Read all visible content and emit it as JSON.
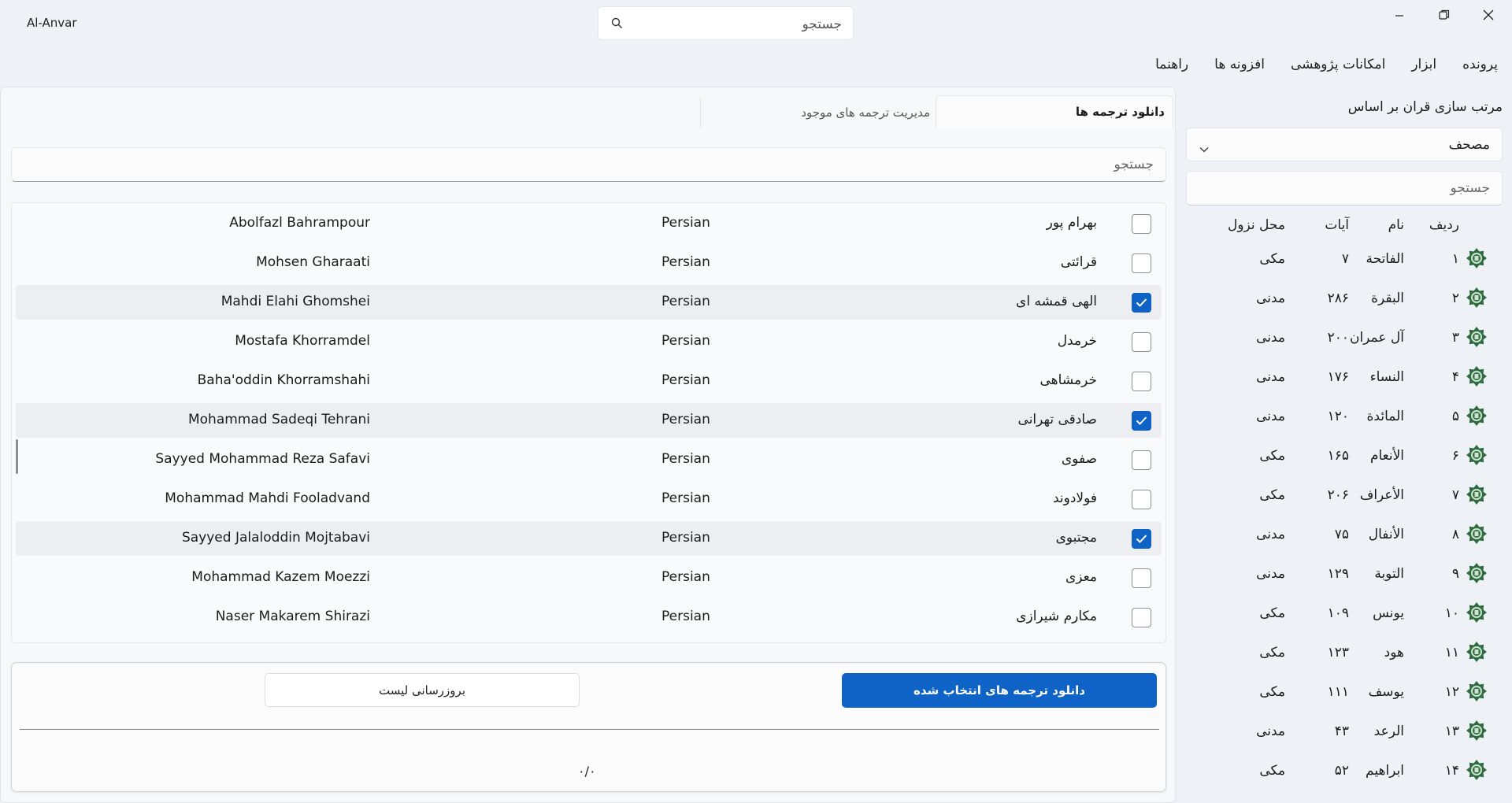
{
  "app": {
    "title": "Al-Anvar"
  },
  "top_search": {
    "placeholder": "جستجو"
  },
  "window_controls": [
    "minimize-icon",
    "restore-icon",
    "close-icon"
  ],
  "menu": [
    "پرونده",
    "ابزار",
    "امکانات پژوهشی",
    "افزونه ها",
    "راهنما"
  ],
  "sidebar": {
    "sort_label": "مرتب سازی قران بر اساس",
    "sort_value": "مصحف",
    "search_placeholder": "جستجو",
    "headers": {
      "index": "ردیف",
      "name": "نام",
      "ayat": "آیات",
      "place": "محل نزول"
    },
    "suras": [
      {
        "index": "۱",
        "name": "الفاتحة",
        "ayat": "۷",
        "place": "مکی"
      },
      {
        "index": "۲",
        "name": "البقرة",
        "ayat": "۲۸۶",
        "place": "مدنی"
      },
      {
        "index": "۳",
        "name": "آل عمران",
        "ayat": "۲۰۰",
        "place": "مدنی"
      },
      {
        "index": "۴",
        "name": "النساء",
        "ayat": "۱۷۶",
        "place": "مدنی"
      },
      {
        "index": "۵",
        "name": "المائدة",
        "ayat": "۱۲۰",
        "place": "مدنی"
      },
      {
        "index": "۶",
        "name": "الأنعام",
        "ayat": "۱۶۵",
        "place": "مکی"
      },
      {
        "index": "۷",
        "name": "الأعراف",
        "ayat": "۲۰۶",
        "place": "مکی"
      },
      {
        "index": "۸",
        "name": "الأنفال",
        "ayat": "۷۵",
        "place": "مدنی"
      },
      {
        "index": "۹",
        "name": "التوبة",
        "ayat": "۱۲۹",
        "place": "مدنی"
      },
      {
        "index": "۱۰",
        "name": "یونس",
        "ayat": "۱۰۹",
        "place": "مکی"
      },
      {
        "index": "۱۱",
        "name": "هود",
        "ayat": "۱۲۳",
        "place": "مکی"
      },
      {
        "index": "۱۲",
        "name": "یوسف",
        "ayat": "۱۱۱",
        "place": "مکی"
      },
      {
        "index": "۱۳",
        "name": "الرعد",
        "ayat": "۴۳",
        "place": "مدنی"
      },
      {
        "index": "۱۴",
        "name": "ابراهیم",
        "ayat": "۵۲",
        "place": "مکی"
      }
    ]
  },
  "tabs": {
    "active": "دانلود ترجمه ها",
    "other": "مدیریت ترجمه های موجود"
  },
  "main_search": {
    "placeholder": "جستجو"
  },
  "translations": [
    {
      "native": "بهرام پور",
      "lang": "Persian",
      "english": "Abolfazl Bahrampour",
      "checked": false
    },
    {
      "native": "قرائتی",
      "lang": "Persian",
      "english": "Mohsen Gharaati",
      "checked": false
    },
    {
      "native": "الهی قمشه ای",
      "lang": "Persian",
      "english": "Mahdi Elahi Ghomshei",
      "checked": true
    },
    {
      "native": "خرمدل",
      "lang": "Persian",
      "english": "Mostafa Khorramdel",
      "checked": false
    },
    {
      "native": "خرمشاهی",
      "lang": "Persian",
      "english": "Baha'oddin Khorramshahi",
      "checked": false
    },
    {
      "native": "صادقی تهرانی",
      "lang": "Persian",
      "english": "Mohammad Sadeqi Tehrani",
      "checked": true
    },
    {
      "native": "صفوی",
      "lang": "Persian",
      "english": "Sayyed Mohammad Reza Safavi",
      "checked": false
    },
    {
      "native": "فولادوند",
      "lang": "Persian",
      "english": "Mohammad Mahdi Fooladvand",
      "checked": false
    },
    {
      "native": "مجتبوی",
      "lang": "Persian",
      "english": "Sayyed Jalaloddin Mojtabavi",
      "checked": true
    },
    {
      "native": "معزی",
      "lang": "Persian",
      "english": "Mohammad Kazem Moezzi",
      "checked": false
    },
    {
      "native": "مکارم شیرازی",
      "lang": "Persian",
      "english": "Naser Makarem Shirazi",
      "checked": false
    }
  ],
  "actions": {
    "download_label": "دانلود ترجمه های انتخاب شده",
    "refresh_label": "بروزرسانی لیست",
    "progress_text": "۰/۰",
    "progress_value": 0
  },
  "colors": {
    "accent": "#0f63c6",
    "emblem": "#2e6b3f"
  }
}
